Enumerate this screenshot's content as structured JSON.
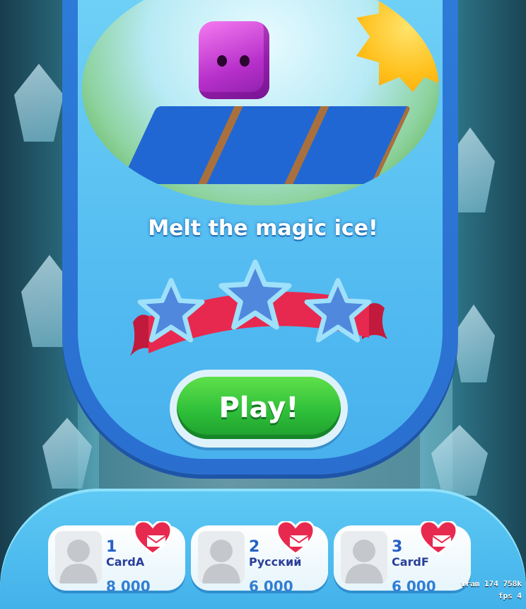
{
  "popup": {
    "title": "Melt the magic ice!",
    "play_label": "Play!",
    "stars": {
      "earned": 0,
      "total": 3
    }
  },
  "leaderboard": [
    {
      "rank": "1",
      "name": "CardA",
      "score": "8 000"
    },
    {
      "rank": "2",
      "name": "Русский",
      "score": "6 000"
    },
    {
      "rank": "3",
      "name": "CardF",
      "score": "6 000"
    }
  ],
  "debug": {
    "vram": "vram 174 758k",
    "fps": "fps 4"
  },
  "colors": {
    "popup_border": "#2a6fd0",
    "popup_fill": "#55bdf1",
    "play_green": "#2fc03a",
    "ribbon_red": "#e8294f",
    "star_blue": "#4f88dd"
  }
}
